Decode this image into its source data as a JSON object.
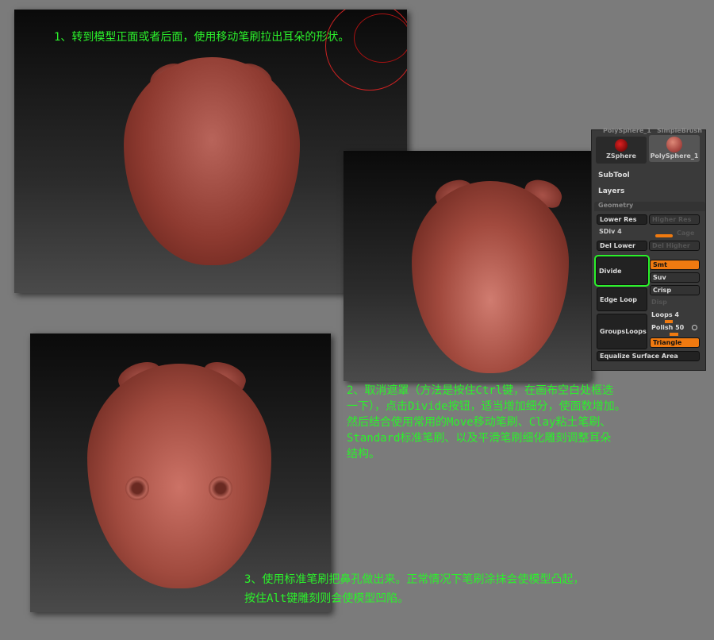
{
  "captions": {
    "step1": "1、转到模型正面或者后面，使用移动笔刷拉出耳朵的形状。",
    "step2": [
      "2、取消遮罩（方法是按住Ctrl键，在画布空白处框选",
      "一下），点击Divide按钮，适当增加细分，使面数增加。",
      "然后结合使用常用的Move移动笔刷、Clay粘土笔刷、",
      "Standard标准笔刷、以及平滑笔刷细化雕刻调整耳朵",
      "结构。"
    ],
    "step3": [
      "3、使用标准笔刷把鼻孔做出来。正常情况下笔刷涂抹会使模型凸起，",
      "按住Alt键雕刻则会使模型凹陷。"
    ]
  },
  "panel": {
    "tools": [
      "ZSphere",
      "PolySphere_1"
    ],
    "top_labels": [
      "PolySphere_1",
      "SimpleBrush"
    ],
    "subtool": "SubTool",
    "layers": "Layers",
    "geometry": "Geometry",
    "lower_res": "Lower Res",
    "higher_res": "Higher Res",
    "sdiv": "SDiv 4",
    "cage": "Cage",
    "del_lower": "Del Lower",
    "del_higher": "Del Higher",
    "divide": "Divide",
    "smt": "Smt",
    "suv": "Suv",
    "edge_loop": "Edge Loop",
    "crisp": "Crisp",
    "disp": "Disp",
    "groups_loops": "GroupsLoops",
    "loops": "Loops 4",
    "polish": "Polish 50",
    "triangle": "Triangle",
    "equalize": "Equalize Surface Area",
    "sdiv_level": 4,
    "loops_value": 4,
    "polish_value": 50,
    "accent": "#f07a10",
    "highlight": "#2bf12b"
  }
}
